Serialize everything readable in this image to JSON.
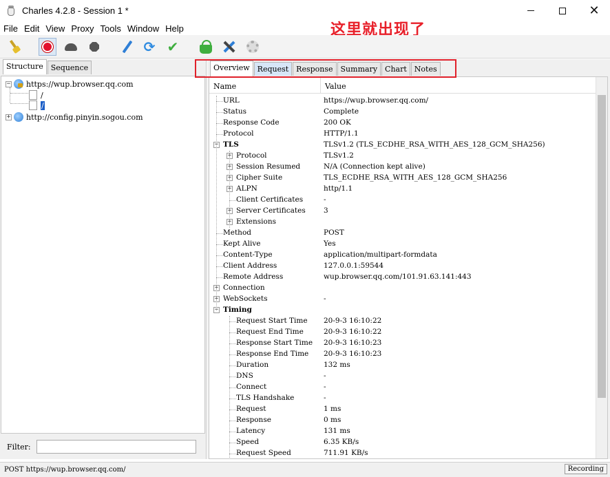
{
  "window": {
    "title": "Charles 4.2.8 - Session 1 *",
    "minimize": "",
    "maximize": "",
    "close": "✕"
  },
  "annotation": "这里就出现了",
  "menu": [
    "File",
    "Edit",
    "View",
    "Proxy",
    "Tools",
    "Window",
    "Help"
  ],
  "toolbar": {
    "icons": [
      "broom-icon",
      "record-icon",
      "turtle-icon",
      "hexagon-icon",
      "pen-icon",
      "refresh-icon",
      "check-icon",
      "basket-icon",
      "tools-icon",
      "gear-icon"
    ],
    "refresh_glyph": "⟳",
    "check_glyph": "✔"
  },
  "left": {
    "tabs": [
      "Structure",
      "Sequence"
    ],
    "tree": {
      "host1": "https://wup.browser.qq.com",
      "host1_child1": "/",
      "host1_child2": "/",
      "host2": "http://config.pinyin.sogou.com"
    },
    "filter_label": "Filter:",
    "filter_value": ""
  },
  "right": {
    "tabs": [
      "Overview",
      "Request",
      "Response",
      "Summary",
      "Chart",
      "Notes"
    ],
    "columns": {
      "name": "Name",
      "value": "Value"
    },
    "rows": [
      {
        "name": "URL",
        "value": "https://wup.browser.qq.com/"
      },
      {
        "name": "Status",
        "value": "Complete"
      },
      {
        "name": "Response Code",
        "value": "200 OK"
      },
      {
        "name": "Protocol",
        "value": "HTTP/1.1"
      },
      {
        "name": "TLS",
        "value": "TLSv1.2 (TLS_ECDHE_RSA_WITH_AES_128_GCM_SHA256)"
      },
      {
        "name": "Protocol",
        "value": "TLSv1.2"
      },
      {
        "name": "Session Resumed",
        "value": "N/A (Connection kept alive)"
      },
      {
        "name": "Cipher Suite",
        "value": "TLS_ECDHE_RSA_WITH_AES_128_GCM_SHA256"
      },
      {
        "name": "ALPN",
        "value": "http/1.1"
      },
      {
        "name": "Client Certificates",
        "value": "-"
      },
      {
        "name": "Server Certificates",
        "value": "3"
      },
      {
        "name": "Extensions",
        "value": ""
      },
      {
        "name": "Method",
        "value": "POST"
      },
      {
        "name": "Kept Alive",
        "value": "Yes"
      },
      {
        "name": "Content-Type",
        "value": "application/multipart-formdata"
      },
      {
        "name": "Client Address",
        "value": "127.0.0.1:59544"
      },
      {
        "name": "Remote Address",
        "value": "wup.browser.qq.com/101.91.63.141:443"
      },
      {
        "name": "Connection",
        "value": ""
      },
      {
        "name": "WebSockets",
        "value": "-"
      },
      {
        "name": "Timing",
        "value": ""
      },
      {
        "name": "Request Start Time",
        "value": "20-9-3 16:10:22"
      },
      {
        "name": "Request End Time",
        "value": "20-9-3 16:10:22"
      },
      {
        "name": "Response Start Time",
        "value": "20-9-3 16:10:23"
      },
      {
        "name": "Response End Time",
        "value": "20-9-3 16:10:23"
      },
      {
        "name": "Duration",
        "value": "132 ms"
      },
      {
        "name": "DNS",
        "value": "-"
      },
      {
        "name": "Connect",
        "value": "-"
      },
      {
        "name": "TLS Handshake",
        "value": "-"
      },
      {
        "name": "Request",
        "value": "1 ms"
      },
      {
        "name": "Response",
        "value": "0 ms"
      },
      {
        "name": "Latency",
        "value": "131 ms"
      },
      {
        "name": "Speed",
        "value": "6.35 KB/s"
      },
      {
        "name": "Request Speed",
        "value": "711.91 KB/s"
      }
    ]
  },
  "status": {
    "text": "POST https://wup.browser.qq.com/",
    "badge": "Recording"
  }
}
